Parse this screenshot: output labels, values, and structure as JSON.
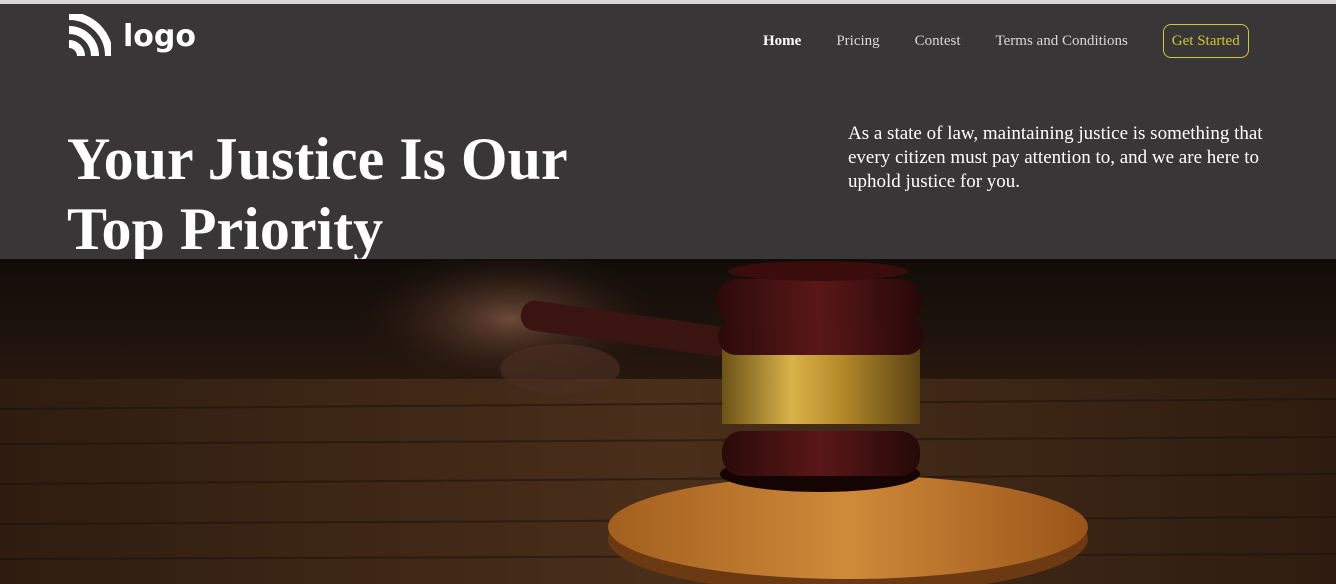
{
  "brand": {
    "logo_text": "logo"
  },
  "nav": {
    "items": [
      {
        "label": "Home",
        "active": true
      },
      {
        "label": "Pricing",
        "active": false
      },
      {
        "label": "Contest",
        "active": false
      },
      {
        "label": "Terms and Conditions",
        "active": false
      }
    ],
    "cta_label": "Get Started"
  },
  "hero": {
    "title_line1": "Your Justice Is Our",
    "title_line2": "Top Priority",
    "description": "As a state of law, maintaining justice is something that every citizen must pay attention to, and we are here to uphold justice for you."
  },
  "colors": {
    "background": "#383637",
    "accent": "#cfc830",
    "text": "#ffffff"
  }
}
